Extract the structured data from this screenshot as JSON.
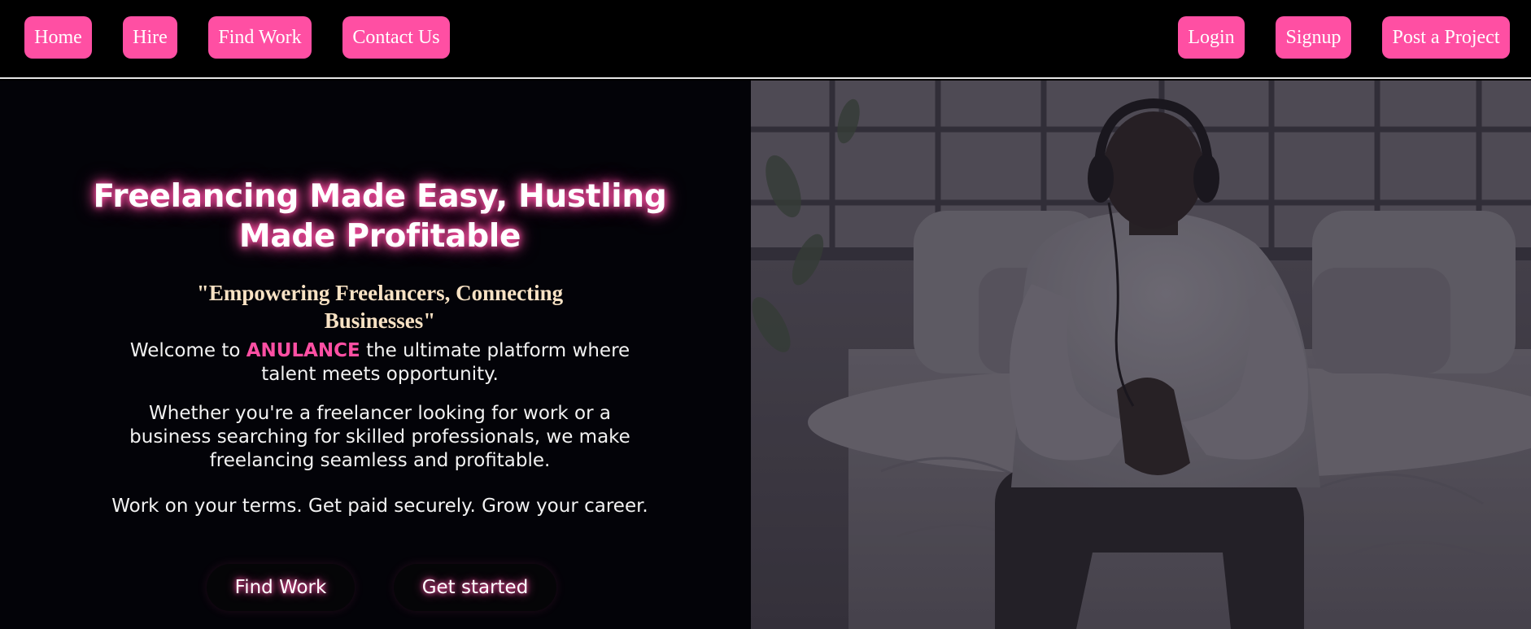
{
  "nav": {
    "home": "Home",
    "hire": "Hire",
    "find_work": "Find Work",
    "contact": "Contact Us",
    "login": "Login",
    "signup": "Signup",
    "post_project": "Post a Project"
  },
  "hero": {
    "title": "Freelancing Made Easy, Hustling Made Profitable",
    "tagline": "\"Empowering Freelancers, Connecting Businesses\"",
    "welcome_prefix": "Welcome to ",
    "brand": "ANULANCE",
    "welcome_suffix": " the ultimate platform where talent meets opportunity.",
    "whether": "Whether you're a freelancer looking for work or a business searching for skilled professionals, we make freelancing seamless and profitable.",
    "terms": "Work on your terms. Get paid securely. Grow your career.",
    "cta_find_work": "Find Work",
    "cta_get_started": "Get started"
  },
  "theme": {
    "accent": "#ff4fa3",
    "nav_bg": "#000000",
    "hero_bg": "#030308",
    "tagline_color": "#f8e2c4"
  }
}
